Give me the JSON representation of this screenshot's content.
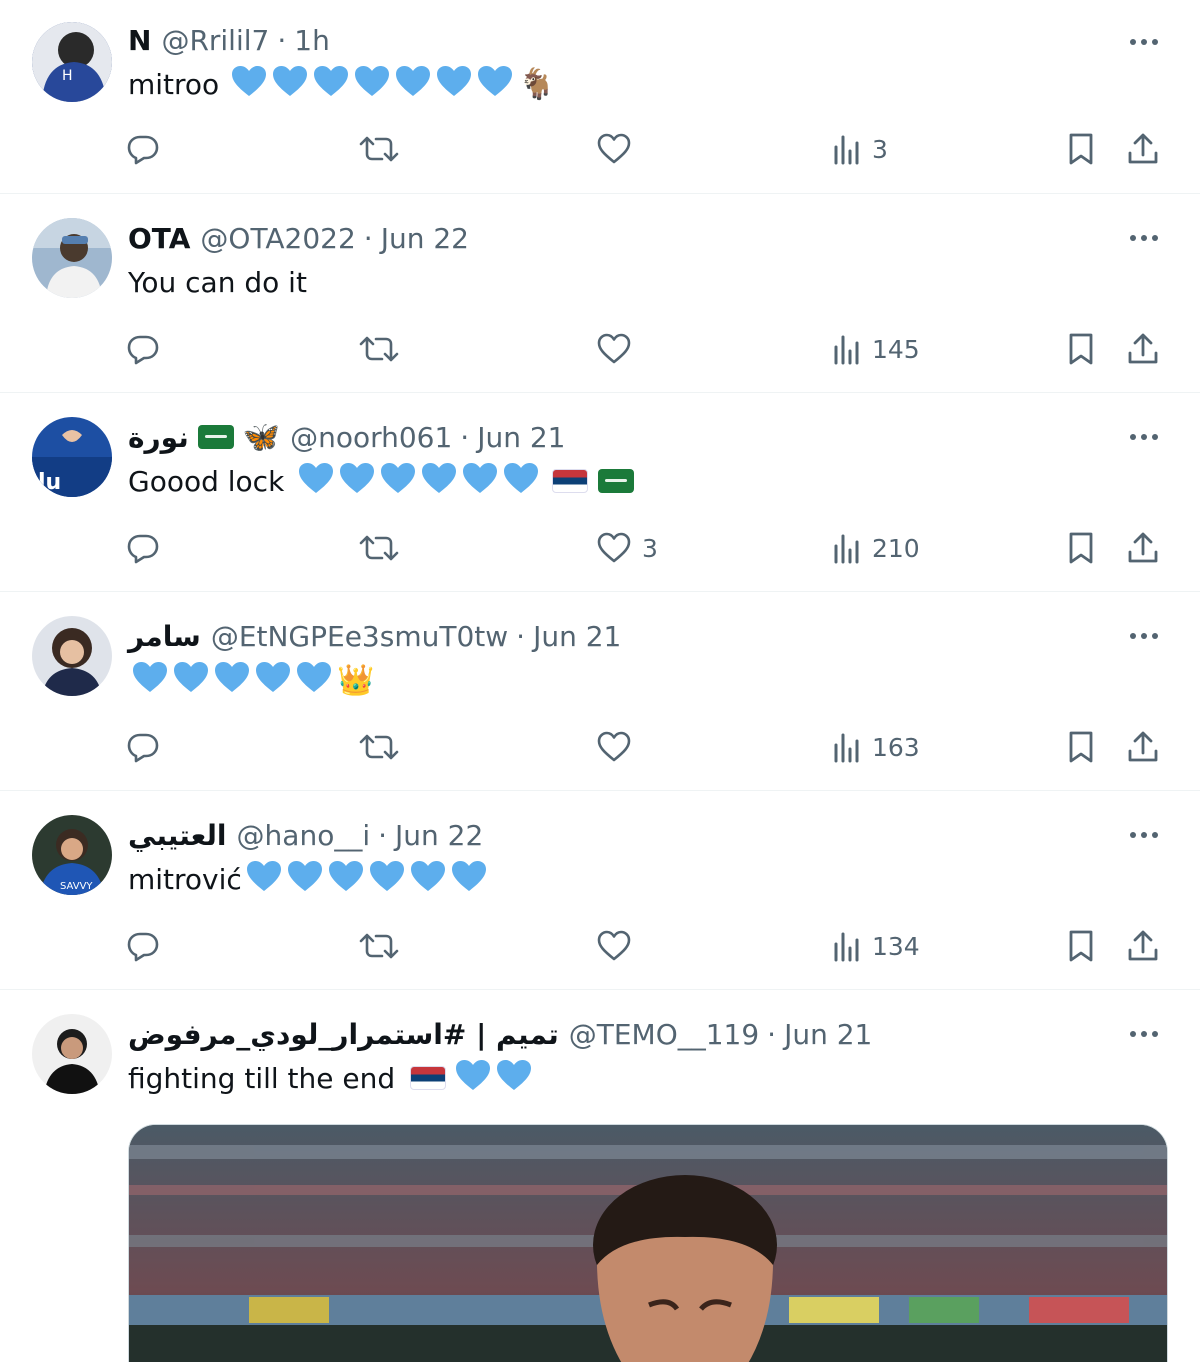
{
  "tweets": [
    {
      "name": "N",
      "handle": "@Rrilil7",
      "time": "1h",
      "text": "mitroo",
      "hearts": 7,
      "trailing": "🐐",
      "reply_count": "",
      "rt_count": "",
      "like_count": "",
      "views": "3",
      "avatar_bg": "#2d4c8c"
    },
    {
      "name": "OTA",
      "handle": "@OTA2022",
      "time": "Jun 22",
      "text": "You can do it",
      "hearts": 0,
      "trailing": "",
      "reply_count": "",
      "rt_count": "",
      "like_count": "",
      "views": "145",
      "avatar_bg": "#8aa9c9"
    },
    {
      "name": "نورة",
      "handle": "@noorh061",
      "time": "Jun 21",
      "text": "Goood lock",
      "hearts": 6,
      "trailing": "",
      "reply_count": "",
      "rt_count": "",
      "like_count": "3",
      "views": "210",
      "avatar_bg": "#1d4fa3"
    },
    {
      "name": "سامر",
      "handle": "@EtNGPEe3smuT0tw",
      "time": "Jun 21",
      "text": "",
      "hearts": 5,
      "trailing": "👑",
      "reply_count": "",
      "rt_count": "",
      "like_count": "",
      "views": "163",
      "avatar_bg": "#34324a"
    },
    {
      "name": "العتيبي",
      "handle": "@hano__i",
      "time": "Jun 22",
      "text": "mitrović",
      "hearts": 6,
      "trailing": "",
      "reply_count": "",
      "rt_count": "",
      "like_count": "",
      "views": "134",
      "avatar_bg": "#1f56b5"
    },
    {
      "name": "تميم | #استمرار_لودي_مرفوض",
      "handle": "@TEMO__119",
      "time": "Jun 21",
      "text": "fighting till the end",
      "hearts": 2,
      "trailing": "",
      "reply_count": "",
      "rt_count": "",
      "like_count": "",
      "views": "",
      "avatar_bg": "#e9e9e9"
    }
  ],
  "separator": "·",
  "butterfly_emoji": "🦋",
  "colors": {
    "heart": "#5daeed",
    "muted": "#536471",
    "text": "#0f1419",
    "divider": "#eff3f4"
  }
}
